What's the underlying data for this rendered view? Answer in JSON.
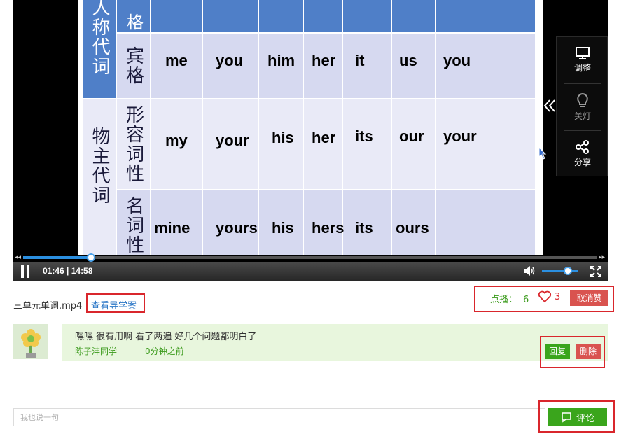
{
  "slide": {
    "col_person_pronoun": "人称代词",
    "col_possessive_pronoun": "物主代词",
    "row_top_label": "格",
    "row_objective": "宾格",
    "row_adjective": "形容词性",
    "row_noun": "名词性",
    "objective_words": [
      "me",
      "you",
      "him",
      "her",
      "it",
      "us",
      "you"
    ],
    "adjective_words": [
      "my",
      "your",
      "his",
      "her",
      "its",
      "our",
      "your"
    ],
    "noun_words": [
      "mine",
      "yours",
      "his",
      "hers",
      "its",
      "ours"
    ]
  },
  "player": {
    "time_display": "01:46 | 14:58",
    "progress_fraction": 0.118,
    "volume_fraction": 0.6,
    "side_menu": {
      "adjust_label": "调整",
      "light_label": "关灯",
      "share_label": "分享"
    }
  },
  "info": {
    "filename": "三单元单词.mp4",
    "guide_link": "查看导学案",
    "plays_label": "点播：",
    "plays_count": "6",
    "likes_count": "3",
    "cancel_like": "取消赞"
  },
  "comment": {
    "text": "嘿嘿 很有用啊 看了两遍 好几个问题都明白了",
    "user": "陈子沣同学",
    "time": "0分钟之前",
    "reply_label": "回复",
    "delete_label": "删除"
  },
  "input": {
    "placeholder": "我也说一句",
    "submit_label": "评论"
  },
  "colors": {
    "accent_green": "#3aa51c",
    "danger_red": "#d9534f",
    "link_blue": "#2a76c6",
    "slide_blue": "#4f7fc8"
  }
}
